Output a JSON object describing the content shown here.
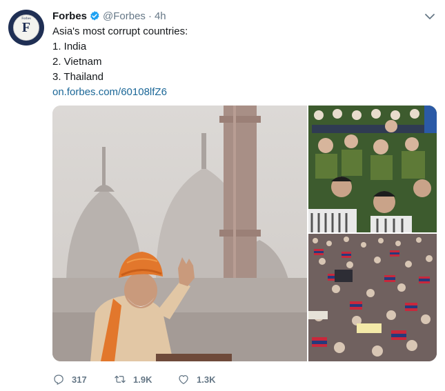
{
  "tweet": {
    "author_name": "Forbes",
    "handle": "@Forbes",
    "separator": "·",
    "time": "4h",
    "avatar_letter": "F",
    "avatar_word": "Forbes",
    "lines": [
      "Asia's most corrupt countries:",
      "1. India",
      "2. Vietnam",
      "3. Thailand"
    ],
    "link": "on.forbes.com/60108lfZ6",
    "icons": {
      "verified": "verified-badge-icon",
      "menu": "chevron-down-icon",
      "reply": "reply-icon",
      "retweet": "retweet-icon",
      "like": "heart-icon"
    },
    "photos": [
      "photo-politician-speech",
      "photo-uniformed-crowd",
      "photo-protest-crowd"
    ],
    "stats": {
      "replies": "317",
      "retweets": "1.9K",
      "likes": "1.3K"
    },
    "colors": {
      "verified_blue": "#1da1f2",
      "link_blue": "#1b6797",
      "secondary_text": "#657786"
    }
  }
}
